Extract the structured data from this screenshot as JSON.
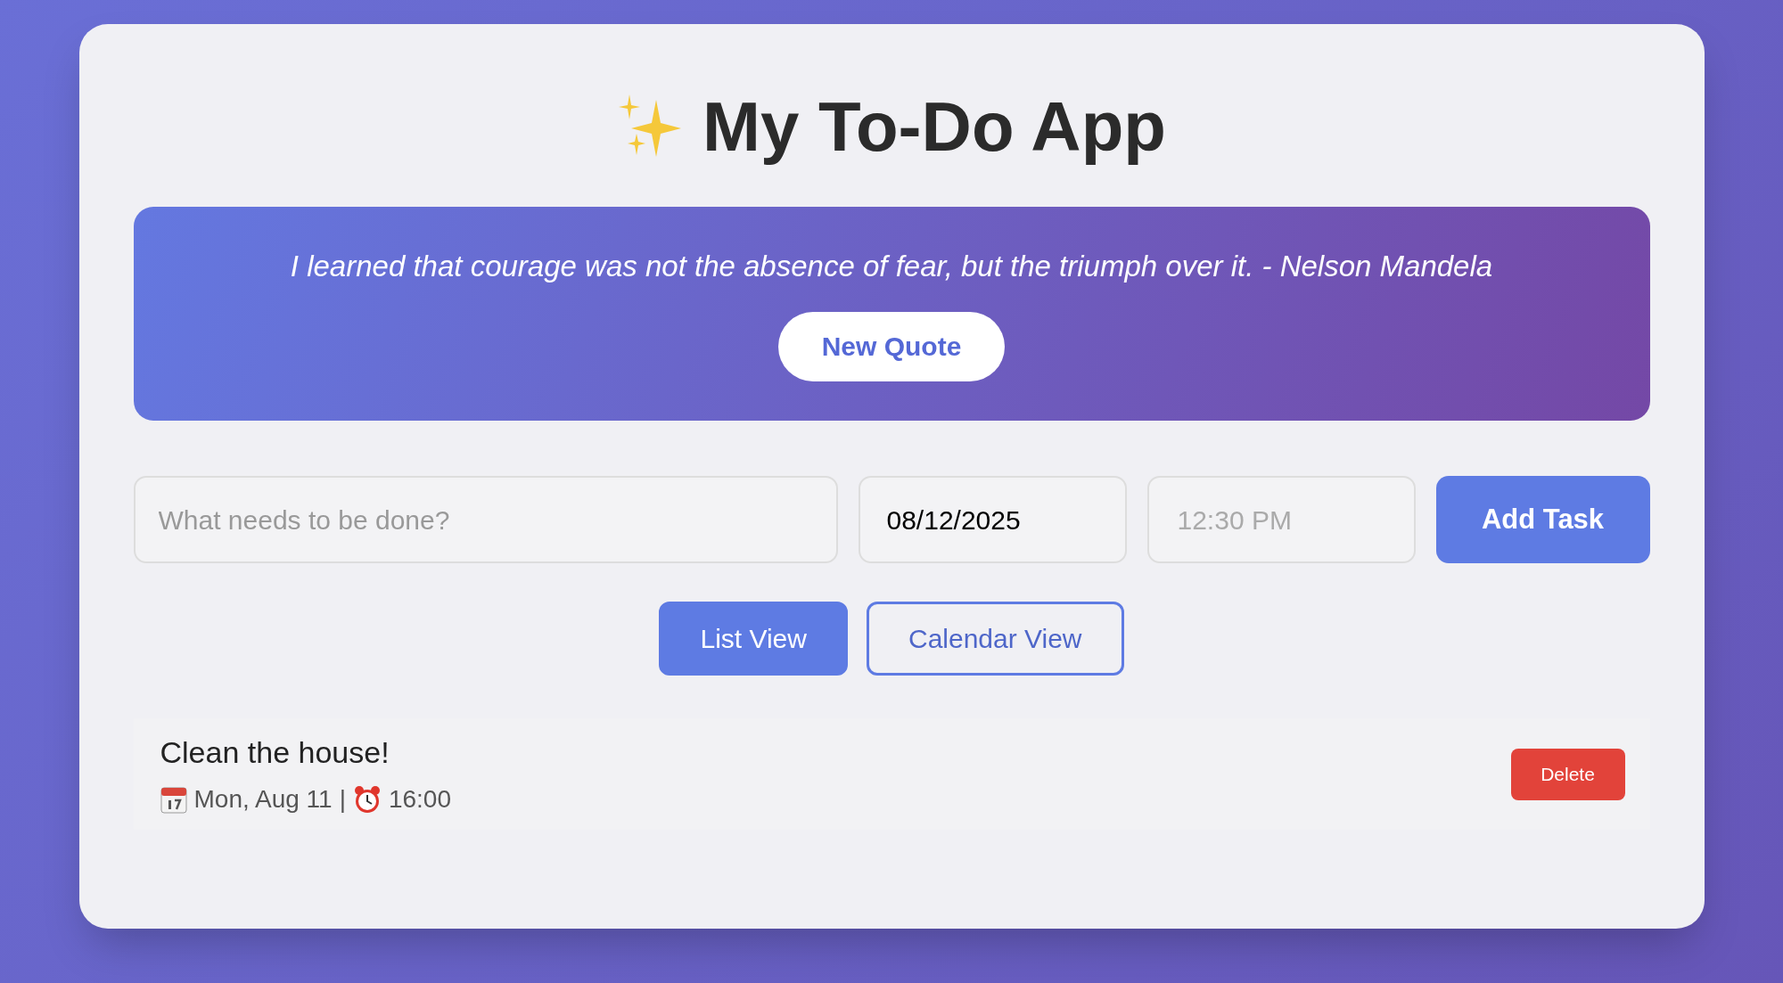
{
  "title": "My To-Do App",
  "quote": {
    "text": "I learned that courage was not the absence of fear, but the triumph over it. - Nelson Mandela",
    "button": "New Quote"
  },
  "form": {
    "task": {
      "placeholder": "What needs to be done?"
    },
    "date": {
      "value": "08/12/2025"
    },
    "time": {
      "placeholder": "12:30 PM"
    },
    "button": "Add Task"
  },
  "views": [
    {
      "label": "List View",
      "selected": true
    },
    {
      "label": "Calendar View",
      "selected": false
    }
  ],
  "tasks": [
    {
      "title": "Clean the house!",
      "date": "Mon, Aug 11",
      "separator": "|",
      "time": "16:00",
      "button": "Delete"
    }
  ]
}
